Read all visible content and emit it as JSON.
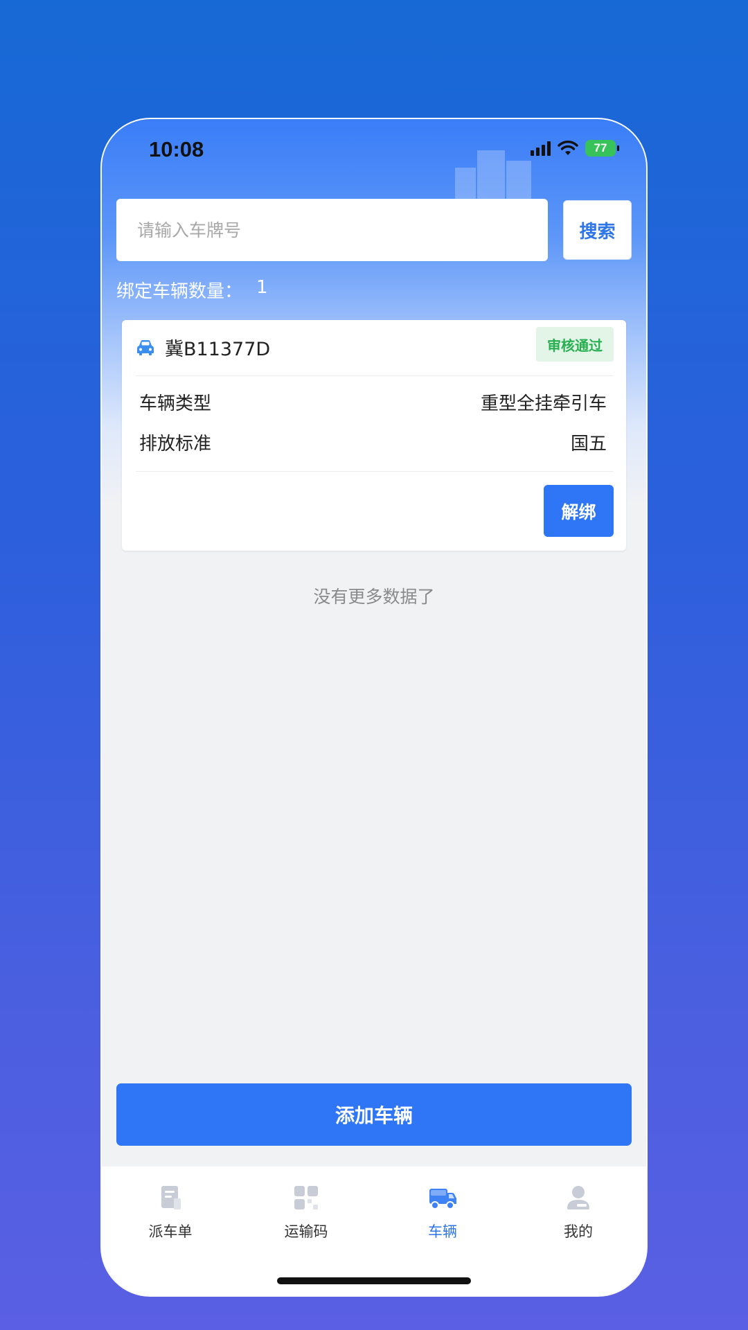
{
  "status_bar": {
    "time": "10:08",
    "battery": "77"
  },
  "search": {
    "placeholder": "请输入车牌号",
    "button_label": "搜索"
  },
  "bound": {
    "label": "绑定车辆数量：",
    "count": "1"
  },
  "vehicles": [
    {
      "plate": "冀B11377D",
      "status": "审核通过",
      "fields": [
        {
          "label": "车辆类型",
          "value": "重型全挂牵引车"
        },
        {
          "label": "排放标准",
          "value": "国五"
        }
      ],
      "action_label": "解绑"
    }
  ],
  "list_end_text": "没有更多数据了",
  "add_button_label": "添加车辆",
  "tabs": [
    {
      "label": "派车单",
      "icon": "dispatch-document-icon",
      "active": false
    },
    {
      "label": "运输码",
      "icon": "qr-code-icon",
      "active": false
    },
    {
      "label": "车辆",
      "icon": "truck-icon",
      "active": true
    },
    {
      "label": "我的",
      "icon": "user-icon",
      "active": false
    }
  ],
  "colors": {
    "primary": "#2E76F6",
    "status_approved_text": "#28B050",
    "status_approved_bg": "#E2F5E7",
    "background_gradient_top": "#1769D6",
    "background_gradient_bottom": "#5A5FE3"
  }
}
